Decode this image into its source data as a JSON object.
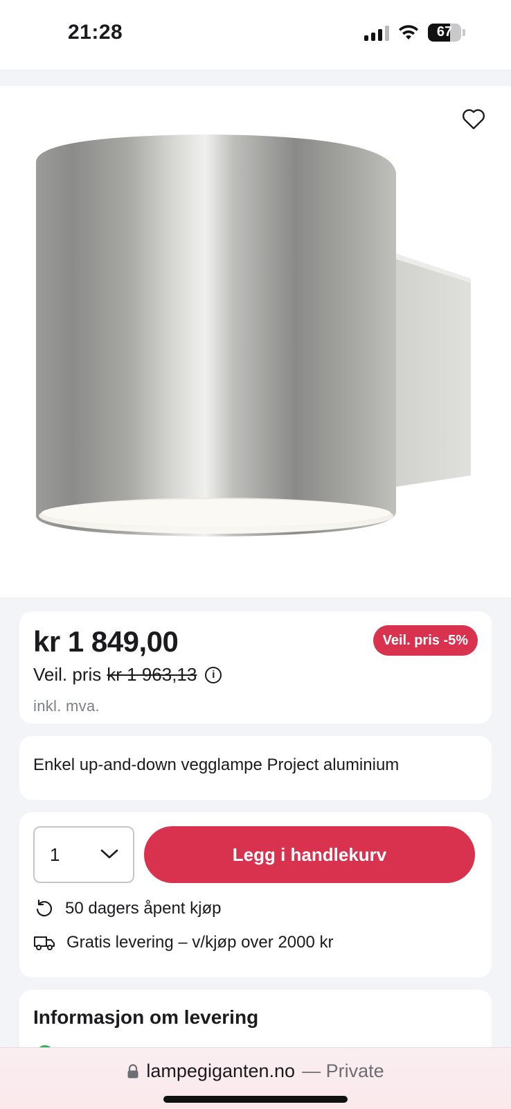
{
  "status": {
    "time": "21:28",
    "battery": "67",
    "battery_level": 0.67
  },
  "product": {
    "favorite_icon": "heart-outline-icon",
    "price": "kr 1 849,00",
    "veil_label": "Veil. pris",
    "veil_price": "kr 1 963,13",
    "info_icon": "i",
    "vat_note": "inkl. mva.",
    "discount_badge": "Veil. pris -5%",
    "title": "Enkel up-and-down vegglampe Project aluminium"
  },
  "cart": {
    "quantity": "1",
    "add_button": "Legg i handlekurv",
    "features": [
      {
        "icon": "return-arrow-icon",
        "text": "50 dagers åpent kjøp"
      },
      {
        "icon": "delivery-truck-icon",
        "text": "Gratis levering – v/kjøp over 2000 kr"
      }
    ]
  },
  "delivery": {
    "title": "Informasjon om levering"
  },
  "browser": {
    "domain": "lampegiganten.no",
    "private_label": "— Private"
  },
  "colors": {
    "accent": "#d9324f",
    "background": "#f3f4f8",
    "muted_text": "#7d7f87"
  }
}
